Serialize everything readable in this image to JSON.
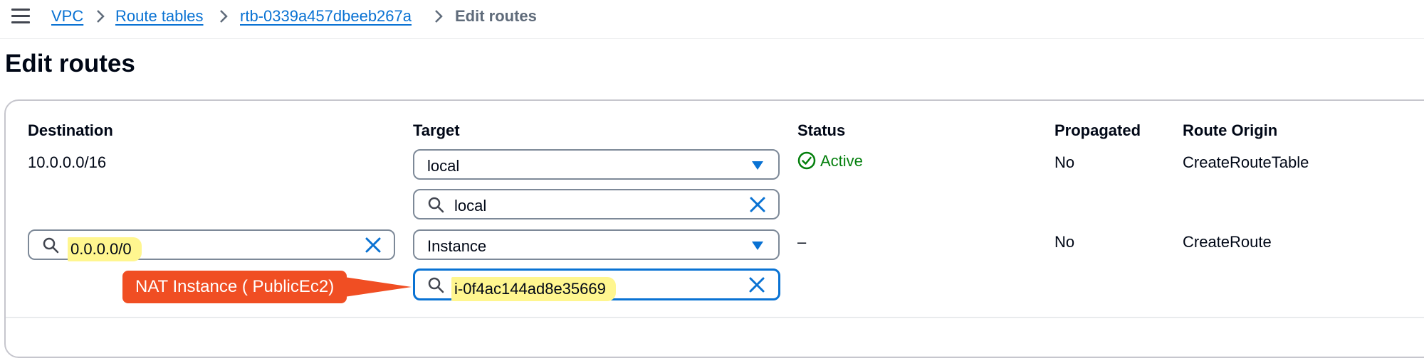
{
  "breadcrumb": {
    "items": [
      "VPC",
      "Route tables",
      "rtb-0339a457dbeeb267a"
    ],
    "current": "Edit routes"
  },
  "page": {
    "title": "Edit routes"
  },
  "table": {
    "headers": {
      "destination": "Destination",
      "target": "Target",
      "status": "Status",
      "propagated": "Propagated",
      "origin": "Route Origin"
    },
    "rows": [
      {
        "destination": "10.0.0.0/16",
        "target_select": "local",
        "target_search": "local",
        "status": "Active",
        "propagated": "No",
        "origin": "CreateRouteTable"
      },
      {
        "destination_search": "0.0.0.0/0",
        "target_select": "Instance",
        "target_search": "i-0f4ac144ad8e35669",
        "status": "–",
        "propagated": "No",
        "origin": "CreateRoute"
      }
    ]
  },
  "annotation": {
    "callout_text": "NAT Instance ( PublicEc2)"
  },
  "icons": {
    "menu": "hamburger-menu-icon",
    "separator": "chevron-right-icon",
    "search": "search-icon",
    "clear": "close-icon",
    "dropdown": "caret-down-icon",
    "status": "check-circle-icon"
  },
  "colors": {
    "link": "#0972d3",
    "status_success": "#037f0c",
    "highlight": "#fff68f",
    "callout": "#f04e23",
    "focus_border": "#0972d3"
  }
}
